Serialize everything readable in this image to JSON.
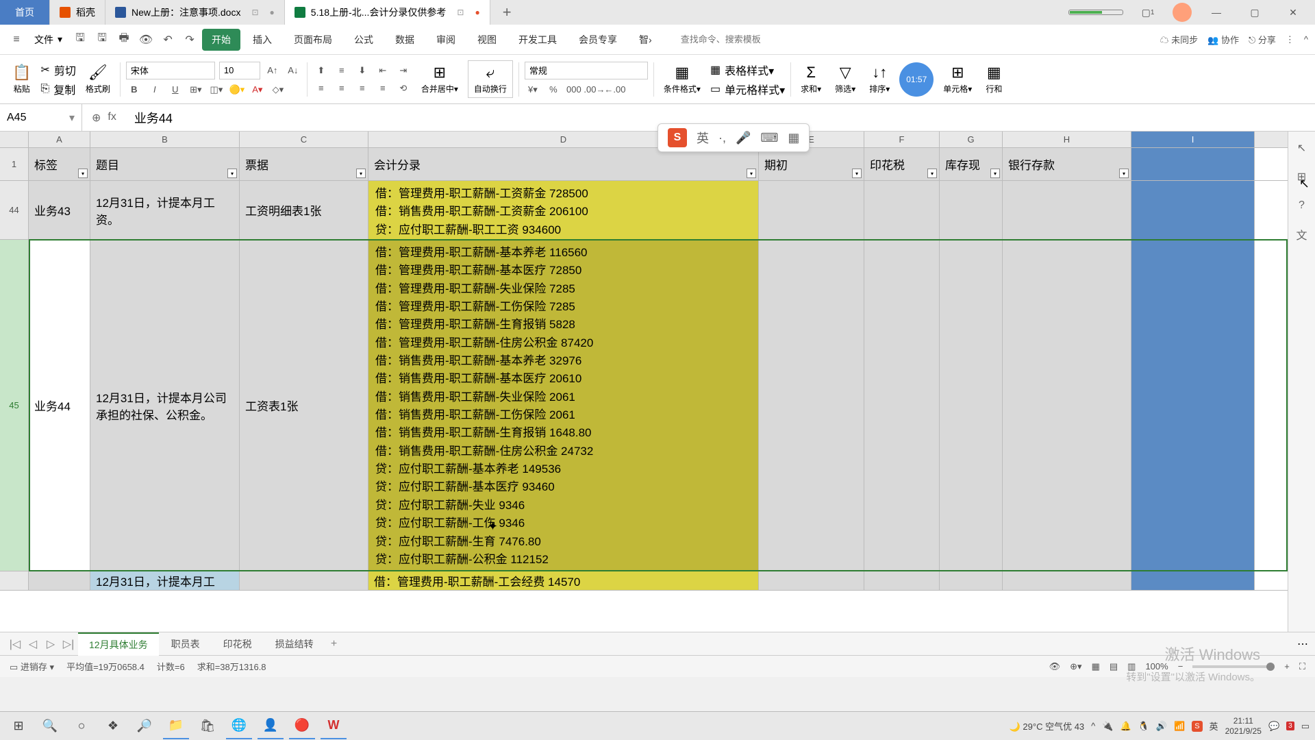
{
  "titlebar": {
    "home": "首页",
    "tabs": [
      {
        "label": "稻壳"
      },
      {
        "label": "New上册：注意事项.docx"
      },
      {
        "label": "5.18上册-北...会计分录仅供参考"
      }
    ],
    "box_icon": "1"
  },
  "menubar": {
    "file": "文件",
    "tabs": [
      "开始",
      "插入",
      "页面布局",
      "公式",
      "数据",
      "审阅",
      "视图",
      "开发工具",
      "会员专享",
      "智"
    ],
    "search_placeholder": "查找命令、搜索模板",
    "unsync": "未同步",
    "collab": "协作",
    "share": "分享"
  },
  "ribbon": {
    "paste": "粘贴",
    "cut": "剪切",
    "copy": "复制",
    "format_painter": "格式刷",
    "font_name": "宋体",
    "font_size": "10",
    "merge": "合并居中",
    "wrap": "自动换行",
    "number_format": "常规",
    "cond_format": "条件格式",
    "table_style": "表格样式",
    "cell_style": "单元格样式",
    "sum": "求和",
    "filter": "筛选",
    "sort": "排序",
    "cell": "单元格",
    "row": "行和",
    "clock": "01:57"
  },
  "ime": {
    "lang": "英"
  },
  "formula": {
    "cell_ref": "A45",
    "value": "业务44"
  },
  "columns": [
    "A",
    "B",
    "C",
    "D",
    "E",
    "F",
    "G",
    "H",
    "I"
  ],
  "headers": {
    "a": "标签",
    "b": "题目",
    "c": "票据",
    "d": "会计分录",
    "e": "期初",
    "f": "印花税",
    "g": "库存现",
    "h": "银行存款"
  },
  "header_row_num": "1",
  "rows": {
    "r44": {
      "num": "44",
      "a": "业务43",
      "b": "12月31日，计提本月工资。",
      "c": "工资明细表1张",
      "d": "借：管理费用-职工薪酬-工资薪金  728500\n借：销售费用-职工薪酬-工资薪金  206100\n贷：应付职工薪酬-职工工资  934600"
    },
    "r45": {
      "num": "45",
      "a": "业务44",
      "b": "12月31日，计提本月公司承担的社保、公积金。",
      "c": "工资表1张",
      "d": "借：管理费用-职工薪酬-基本养老  116560\n借：管理费用-职工薪酬-基本医疗  72850\n借：管理费用-职工薪酬-失业保险  7285\n借：管理费用-职工薪酬-工伤保险  7285\n借：管理费用-职工薪酬-生育报销  5828\n借：管理费用-职工薪酬-住房公积金  87420\n借：销售费用-职工薪酬-基本养老  32976\n借：销售费用-职工薪酬-基本医疗  20610\n借：销售费用-职工薪酬-失业保险  2061\n借：销售费用-职工薪酬-工伤保险  2061\n借：销售费用-职工薪酬-生育报销  1648.80\n借：销售费用-职工薪酬-住房公积金  24732\n贷：应付职工薪酬-基本养老  149536\n贷：应付职工薪酬-基本医疗  93460\n贷：应付职工薪酬-失业  9346\n贷：应付职工薪酬-工伤  9346\n贷：应付职工薪酬-生育  7476.80\n贷：应付职工薪酬-公积金  112152"
    },
    "r46": {
      "b": "12月31日，计提本月工",
      "d": "借：管理费用-职工薪酬-工会经费  14570"
    }
  },
  "sheets": {
    "tabs": [
      "12月具体业务",
      "职员表",
      "印花税",
      "损益结转"
    ]
  },
  "statusbar": {
    "mode": "进销存",
    "avg": "平均值=19万0658.4",
    "count": "计数=6",
    "sum": "求和=38万1316.8",
    "zoom": "100%"
  },
  "watermark": {
    "line1": "激活 Windows",
    "line2": "转到\"设置\"以激活 Windows。"
  },
  "taskbar": {
    "weather": "29°C 空气优 43",
    "time": "21:11",
    "date": "2021/9/25"
  }
}
